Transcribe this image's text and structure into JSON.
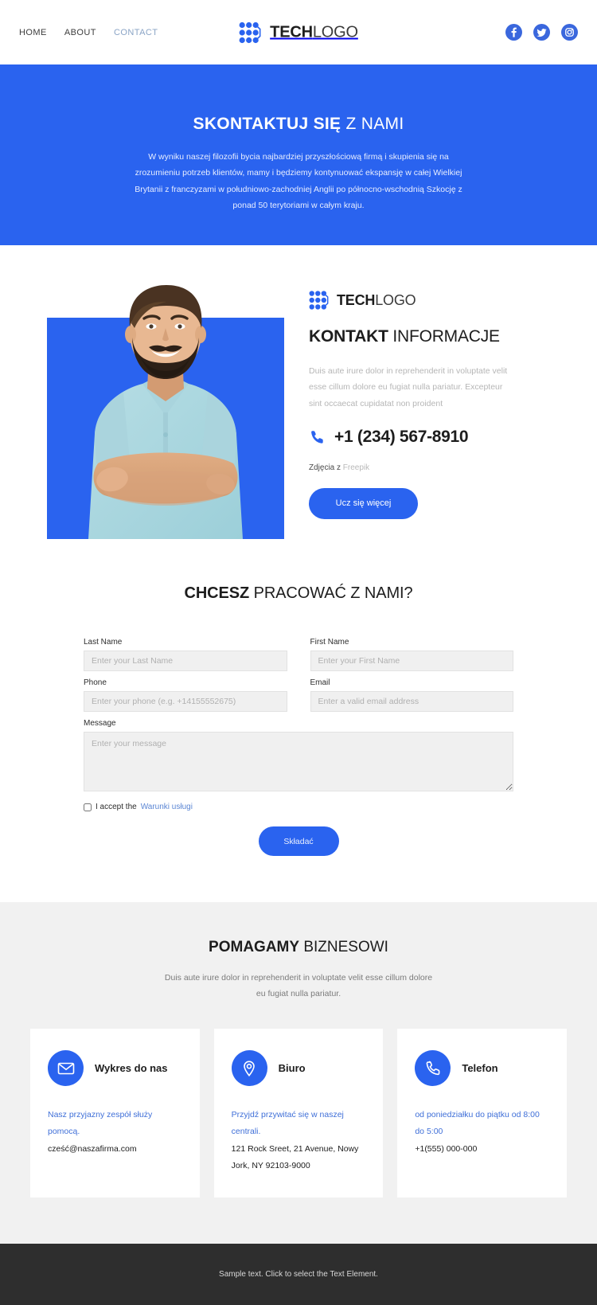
{
  "header": {
    "nav": [
      {
        "label": "HOME",
        "active": false
      },
      {
        "label": "ABOUT",
        "active": false
      },
      {
        "label": "CONTACT",
        "active": true
      }
    ],
    "brand": {
      "bold": "TECH",
      "light": "LOGO"
    },
    "socials": [
      {
        "name": "facebook-icon",
        "label": "Facebook"
      },
      {
        "name": "twitter-icon",
        "label": "Twitter"
      },
      {
        "name": "instagram-icon",
        "label": "Instagram"
      }
    ]
  },
  "hero": {
    "title_bold": "SKONTAKTUJ SIĘ",
    "title_light": " Z NAMI",
    "paragraph": "W wyniku naszej filozofii bycia najbardziej przyszłościową firmą i skupienia się na zrozumieniu potrzeb klientów, mamy i będziemy kontynuować ekspansję w całej Wielkiej Brytanii z franczyzami w południowo-zachodniej Anglii po północno-wschodnią Szkocję z ponad 50 terytoriami w całym kraju."
  },
  "info": {
    "brand": {
      "bold": "TECH",
      "light": "LOGO"
    },
    "title_bold": "KONTAKT",
    "title_light": " INFORMACJE",
    "description": "Duis aute irure dolor in reprehenderit in voluptate velit esse cillum dolore eu fugiat nulla pariatur. Excepteur sint occaecat cupidatat non proident",
    "phone": "+1 (234) 567-8910",
    "phone_icon": "phone-icon",
    "credit_prefix": "Zdjęcia z ",
    "credit_source": "Freepik",
    "cta_label": "Ucz się więcej",
    "photo_alt": "Smiling bearded man with arms crossed"
  },
  "form": {
    "title_bold": "CHCESZ",
    "title_light": " PRACOWAĆ Z NAMI?",
    "fields": [
      {
        "label": "Last Name",
        "placeholder": "Enter your Last Name",
        "value": "",
        "name": "last-name"
      },
      {
        "label": "First Name",
        "placeholder": "Enter your First Name",
        "value": "",
        "name": "first-name"
      },
      {
        "label": "Phone",
        "placeholder": "Enter your phone (e.g. +14155552675)",
        "value": "",
        "name": "phone"
      },
      {
        "label": "Email",
        "placeholder": "Enter a valid email address",
        "value": "",
        "name": "email"
      }
    ],
    "message": {
      "label": "Message",
      "placeholder": "Enter your message",
      "value": ""
    },
    "accept_prefix": "I accept the ",
    "accept_link": "Warunki usługi",
    "accept_checked": false,
    "submit_label": "Składać"
  },
  "cards_section": {
    "title_bold": "POMAGAMY",
    "title_light": " BIZNESOWI",
    "subtitle": "Duis aute irure dolor in reprehenderit in voluptate velit esse cillum dolore eu fugiat nulla pariatur.",
    "cards": [
      {
        "icon": "envelope-icon",
        "title": "Wykres do nas",
        "line1": "Nasz przyjazny zespół służy pomocą.",
        "line2": "cześć@naszafirma.com"
      },
      {
        "icon": "map-pin-icon",
        "title": "Biuro",
        "line1": "Przyjdź przywitać się w naszej centrali.",
        "line2": "121 Rock Sreet, 21 Avenue, Nowy Jork, NY 92103-9000"
      },
      {
        "icon": "phone-icon",
        "title": "Telefon",
        "line1": "od poniedziałku do piątku od 8:00 do 5:00",
        "line2": "+1(555) 000-000"
      }
    ]
  },
  "footer": {
    "text": "Sample text. Click to select the Text Element."
  },
  "colors": {
    "brand_blue": "#2a63ef",
    "link_blue": "#3f6fd8",
    "footer_bg": "#2e2e2e",
    "section_bg": "#f1f1f1"
  }
}
